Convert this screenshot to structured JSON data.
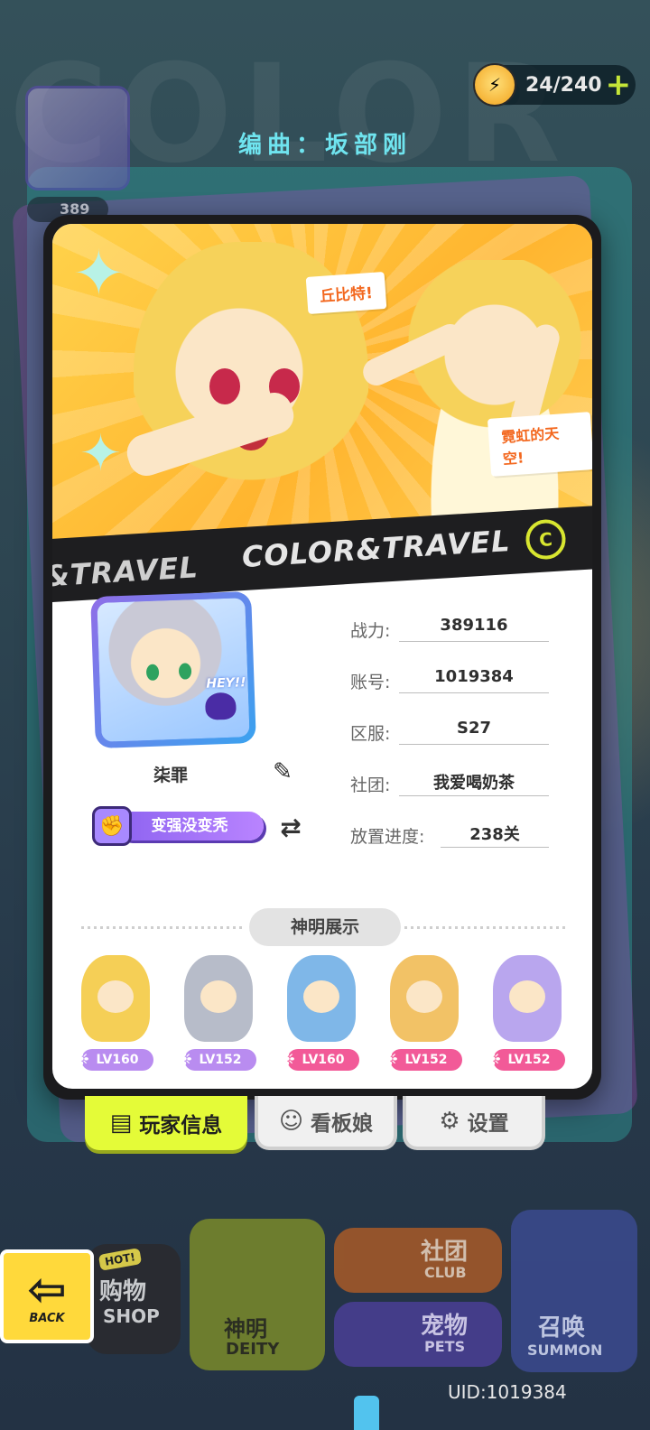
{
  "header": {
    "composer_text": "编曲：坂部刚",
    "stamina": "24/240",
    "stamina_plus": "+",
    "bg_power": "389"
  },
  "banner": {
    "strip_left": "&TRAVEL",
    "strip_main": "COLOR&TRAVEL",
    "bubble_1": "丘比特!",
    "bubble_2": "霓虹的天空!"
  },
  "profile": {
    "avatar_hey": "HEY!!",
    "name": "柒罪",
    "title": "变强没变秃",
    "switch_icon": "⇄",
    "fields": [
      {
        "label": "战力:",
        "value": "389116"
      },
      {
        "label": "账号:",
        "value": "1019384"
      },
      {
        "label": "区服:",
        "value": "S27"
      },
      {
        "label": "社团:",
        "value": "我爱喝奶茶"
      },
      {
        "label": "放置进度:",
        "value": "238关"
      }
    ]
  },
  "deity_section": {
    "title": "神明展示",
    "items": [
      {
        "level": "LV160",
        "hair": "#f5cf56",
        "lv_color": "#b98cf0"
      },
      {
        "level": "LV152",
        "hair": "#b7bcc9",
        "lv_color": "#b98cf0"
      },
      {
        "level": "LV160",
        "hair": "#7fb7e8",
        "lv_color": "#f25a98"
      },
      {
        "level": "LV152",
        "hair": "#f2c266",
        "lv_color": "#f25a98"
      },
      {
        "level": "LV152",
        "hair": "#b9a6ee",
        "lv_color": "#f25a98"
      }
    ]
  },
  "tabs": [
    {
      "label": "玩家信息",
      "icon": "id-card-icon",
      "active": true
    },
    {
      "label": "看板娘",
      "icon": "person-swap-icon",
      "active": false
    },
    {
      "label": "设置",
      "icon": "gear-icon",
      "active": false
    }
  ],
  "bottom_nav": {
    "back": "BACK",
    "shop_cn": "购物",
    "shop_en": "SHOP",
    "shop_hot": "HOT!",
    "deity_cn": "神明",
    "deity_en": "DEITY",
    "club_cn": "社团",
    "club_en": "CLUB",
    "pets_cn": "宠物",
    "pets_en": "PETS",
    "summon_cn": "召唤",
    "summon_en": "SUMMON"
  },
  "footer": {
    "uid": "UID:1019384"
  }
}
